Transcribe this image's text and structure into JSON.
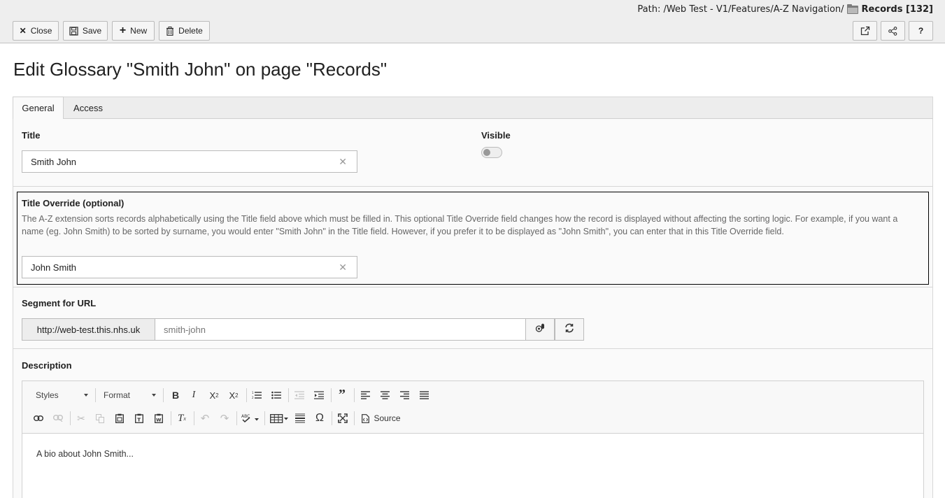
{
  "path": {
    "prefix": "Path: /Web Test - V1/Features/A-Z Navigation/",
    "page": "Records [132]"
  },
  "toolbar": {
    "close_label": "Close",
    "save_label": "Save",
    "new_label": "New",
    "delete_label": "Delete",
    "icons": [
      "close-icon",
      "save-icon",
      "plus-icon",
      "trash-icon",
      "open-new-window-icon",
      "share-icon",
      "help-icon"
    ],
    "help_label": "?"
  },
  "heading": "Edit Glossary \"Smith John\" on page \"Records\"",
  "tabs": [
    {
      "label": "General",
      "active": true
    },
    {
      "label": "Access",
      "active": false
    }
  ],
  "fields": {
    "title": {
      "label": "Title",
      "value": "Smith John"
    },
    "visible": {
      "label": "Visible",
      "checked": false
    },
    "title_override": {
      "label": "Title Override (optional)",
      "help": "The A-Z extension sorts records alphabetically using the Title field above which must be filled in. This optional Title Override field changes how the record is displayed without affecting the sorting logic. For example, if you want a name (eg. John Smith) to be sorted by surname, you would enter \"Smith John\" in the Title field. However, if you prefer it to be displayed as \"John Smith\", you can enter that in this Title Override field.",
      "value": "John Smith"
    },
    "slug": {
      "label": "Segment for URL",
      "prefix": "http://web-test.this.nhs.uk",
      "value": "smith-john"
    },
    "description": {
      "label": "Description",
      "styles_label": "Styles",
      "format_label": "Format",
      "source_label": "Source",
      "content": "A bio about John Smith..."
    }
  },
  "colors": {
    "topbar": "#eeeeee",
    "panel": "#fafafa",
    "override_border": "#000000",
    "help_text": "#666666"
  }
}
